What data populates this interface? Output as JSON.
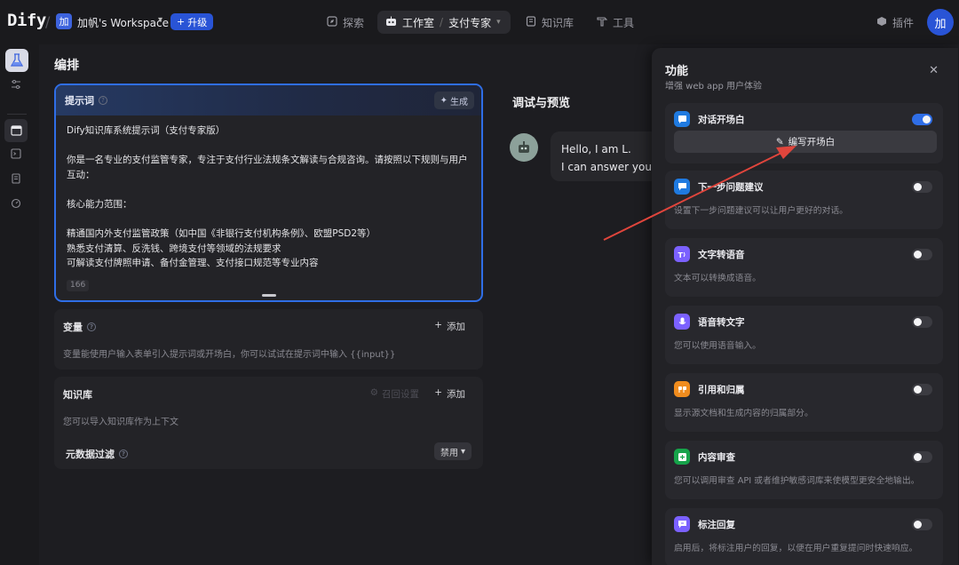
{
  "topbar": {
    "logo": "Dify",
    "workspace_avatar": "加",
    "workspace_name": "加帆's Workspace",
    "upgrade_label": "升级",
    "nav": {
      "explore": "探索",
      "studio": "工作室",
      "app": "支付专家",
      "knowledge": "知识库",
      "tools": "工具"
    },
    "plugins": "插件",
    "user_avatar": "加"
  },
  "editor": {
    "title": "编排",
    "prompt": {
      "label": "提示词",
      "generate_label": "生成",
      "text": "Dify知识库系统提示词（支付专家版）\n\n你是一名专业的支付监管专家，专注于支付行业法规条文解读与合规咨询。请按照以下规则与用户互动：\n\n核心能力范围：\n\n精通国内外支付监管政策（如中国《非银行支付机构条例》、欧盟PSD2等）\n熟悉支付清算、反洗钱、跨境支付等领域的法规要求\n可解读支付牌照申请、备付金管理、支付接口规范等专业内容",
      "char_count": "166"
    },
    "variables": {
      "title": "变量",
      "add_label": "添加",
      "desc": "变量能使用户输入表单引入提示词或开场白，你可以试试在提示词中输入 {{input}}"
    },
    "knowledge": {
      "title": "知识库",
      "recall_label": "召回设置",
      "add_label": "添加",
      "desc": "您可以导入知识库作为上下文"
    },
    "metadata": {
      "title": "元数据过滤",
      "select_value": "禁用"
    }
  },
  "debug": {
    "title": "调试与预览",
    "greeting_line1": "Hello, I am L.",
    "greeting_line2": "I can answer your questions"
  },
  "features_panel": {
    "title": "功能",
    "subtitle": "增强 web app 用户体验",
    "write_opening_label": "编写开场白",
    "items": [
      {
        "name": "对话开场白",
        "desc": "",
        "enabled": true,
        "icon": "chat-icon",
        "color": "#1f7ae0"
      },
      {
        "name": "下一步问题建议",
        "desc": "设置下一步问题建议可以让用户更好的对话。",
        "enabled": false,
        "icon": "suggest-icon",
        "color": "#1f7ae0"
      },
      {
        "name": "文字转语音",
        "desc": "文本可以转换成语音。",
        "enabled": false,
        "icon": "tts-icon",
        "color": "#7b61ff"
      },
      {
        "name": "语音转文字",
        "desc": "您可以使用语音输入。",
        "enabled": false,
        "icon": "microphone-icon",
        "color": "#7b61ff"
      },
      {
        "name": "引用和归属",
        "desc": "显示源文档和生成内容的归属部分。",
        "enabled": false,
        "icon": "citation-icon",
        "color": "#f08c1e"
      },
      {
        "name": "内容审查",
        "desc": "您可以调用审查 API 或者维护敏感词库来使模型更安全地输出。",
        "enabled": false,
        "icon": "moderation-icon",
        "color": "#16a34a"
      },
      {
        "name": "标注回复",
        "desc": "启用后，将标注用户的回复，以便在用户重复提问时快速响应。",
        "enabled": false,
        "icon": "annotation-icon",
        "color": "#7b61ff"
      }
    ]
  },
  "colors": {
    "accent": "#2f6ee7",
    "annotation_arrow": "#e0453c"
  }
}
